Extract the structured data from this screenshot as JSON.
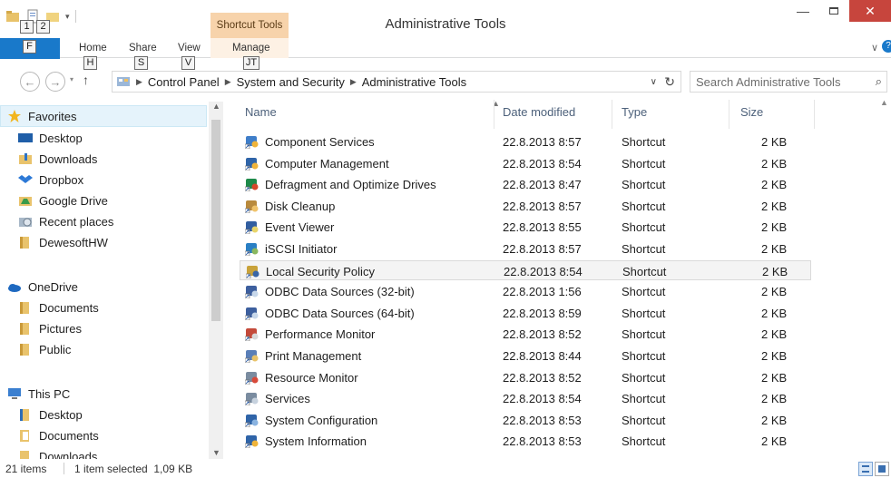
{
  "window": {
    "title": "Administrative Tools",
    "context_tab": "Shortcut Tools"
  },
  "qat_keytips": [
    "1",
    "2"
  ],
  "ribbon": {
    "tabs": [
      {
        "label": "Home",
        "keytip": "H"
      },
      {
        "label": "Share",
        "keytip": "S"
      },
      {
        "label": "View",
        "keytip": "V"
      },
      {
        "label": "Manage",
        "keytip": "JT"
      }
    ],
    "file_keytip": "F"
  },
  "address": {
    "crumbs": [
      "Control Panel",
      "System and Security",
      "Administrative Tools"
    ],
    "search_placeholder": "Search Administrative Tools"
  },
  "nav": {
    "favorites": {
      "label": "Favorites",
      "items": [
        "Desktop",
        "Downloads",
        "Dropbox",
        "Google Drive",
        "Recent places",
        "DewesoftHW"
      ]
    },
    "onedrive": {
      "label": "OneDrive",
      "items": [
        "Documents",
        "Pictures",
        "Public"
      ]
    },
    "thispc": {
      "label": "This PC",
      "items": [
        "Desktop",
        "Documents",
        "Downloads"
      ]
    }
  },
  "columns": {
    "name": "Name",
    "date": "Date modified",
    "type": "Type",
    "size": "Size"
  },
  "files": [
    {
      "name": "Component Services",
      "date": "22.8.2013 8:57",
      "type": "Shortcut",
      "size": "2 KB",
      "icon": "component-services-icon"
    },
    {
      "name": "Computer Management",
      "date": "22.8.2013 8:54",
      "type": "Shortcut",
      "size": "2 KB",
      "icon": "computer-management-icon"
    },
    {
      "name": "Defragment and Optimize Drives",
      "date": "22.8.2013 8:47",
      "type": "Shortcut",
      "size": "2 KB",
      "icon": "defragment-icon"
    },
    {
      "name": "Disk Cleanup",
      "date": "22.8.2013 8:57",
      "type": "Shortcut",
      "size": "2 KB",
      "icon": "disk-cleanup-icon"
    },
    {
      "name": "Event Viewer",
      "date": "22.8.2013 8:55",
      "type": "Shortcut",
      "size": "2 KB",
      "icon": "event-viewer-icon"
    },
    {
      "name": "iSCSI Initiator",
      "date": "22.8.2013 8:57",
      "type": "Shortcut",
      "size": "2 KB",
      "icon": "iscsi-icon"
    },
    {
      "name": "Local Security Policy",
      "date": "22.8.2013 8:54",
      "type": "Shortcut",
      "size": "2 KB",
      "icon": "security-policy-icon"
    },
    {
      "name": "ODBC Data Sources (32-bit)",
      "date": "22.8.2013 1:56",
      "type": "Shortcut",
      "size": "2 KB",
      "icon": "odbc-icon"
    },
    {
      "name": "ODBC Data Sources (64-bit)",
      "date": "22.8.2013 8:59",
      "type": "Shortcut",
      "size": "2 KB",
      "icon": "odbc-icon"
    },
    {
      "name": "Performance Monitor",
      "date": "22.8.2013 8:52",
      "type": "Shortcut",
      "size": "2 KB",
      "icon": "performance-monitor-icon"
    },
    {
      "name": "Print Management",
      "date": "22.8.2013 8:44",
      "type": "Shortcut",
      "size": "2 KB",
      "icon": "print-management-icon"
    },
    {
      "name": "Resource Monitor",
      "date": "22.8.2013 8:52",
      "type": "Shortcut",
      "size": "2 KB",
      "icon": "resource-monitor-icon"
    },
    {
      "name": "Services",
      "date": "22.8.2013 8:54",
      "type": "Shortcut",
      "size": "2 KB",
      "icon": "services-icon"
    },
    {
      "name": "System Configuration",
      "date": "22.8.2013 8:53",
      "type": "Shortcut",
      "size": "2 KB",
      "icon": "system-configuration-icon"
    },
    {
      "name": "System Information",
      "date": "22.8.2013 8:53",
      "type": "Shortcut",
      "size": "2 KB",
      "icon": "system-information-icon"
    }
  ],
  "selected_file": "Local Security Policy",
  "status": {
    "count": "21 items",
    "selection": "1 item selected  1,09 KB"
  },
  "colors": {
    "accent": "#1979ca",
    "close": "#c7453d",
    "context_tab": "#f7d3ab",
    "selection": "#f4f4f4",
    "header_text": "#4c607a"
  }
}
